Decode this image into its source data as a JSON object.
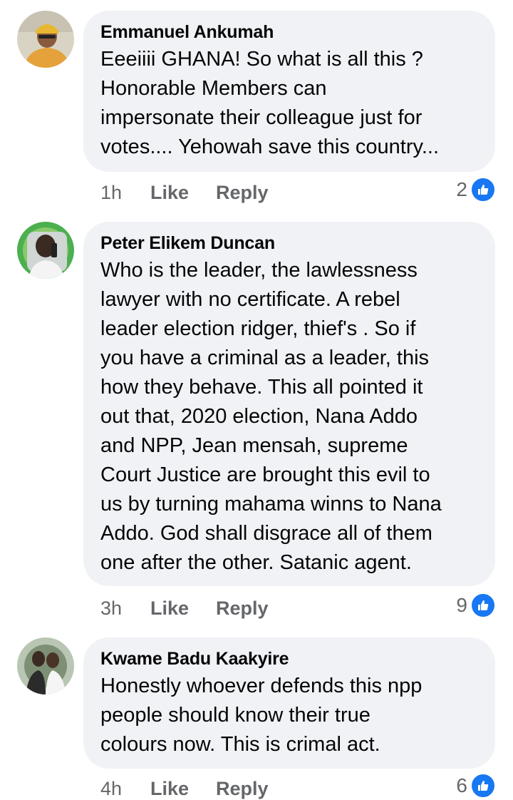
{
  "accent_color": "#1877f2",
  "comments": [
    {
      "author": "Emmanuel Ankumah",
      "text": "Eeeiiii GHANA! So what is all this ?\nHonorable Members can\nimpersonate their colleague just for\nvotes.... Yehowah save this country...",
      "time": "1h",
      "like_label": "Like",
      "reply_label": "Reply",
      "reaction_count": "2",
      "reaction_icon": "thumbs-up-icon",
      "avatar_icon": "profile-photo"
    },
    {
      "author": "Peter Elikem Duncan",
      "text": "Who is the leader,  the lawlessness\nlawyer with no certificate. A rebel\nleader election ridger, thief's . So if\nyou have a criminal as a leader, this\nhow they behave. This all pointed it\nout that, 2020 election, Nana Addo\nand NPP, Jean mensah, supreme\nCourt Justice are brought this evil to\nus by turning mahama winns to Nana\nAddo. God shall disgrace all of them\none after the other. Satanic agent.",
      "time": "3h",
      "like_label": "Like",
      "reply_label": "Reply",
      "reaction_count": "9",
      "reaction_icon": "thumbs-up-icon",
      "avatar_icon": "profile-photo"
    },
    {
      "author": "Kwame Badu Kaakyire",
      "text": "Honestly whoever defends this npp\npeople should know their true\ncolours now. This is crimal act.",
      "time": "4h",
      "like_label": "Like",
      "reply_label": "Reply",
      "reaction_count": "6",
      "reaction_icon": "thumbs-up-icon",
      "avatar_icon": "profile-photo"
    }
  ]
}
